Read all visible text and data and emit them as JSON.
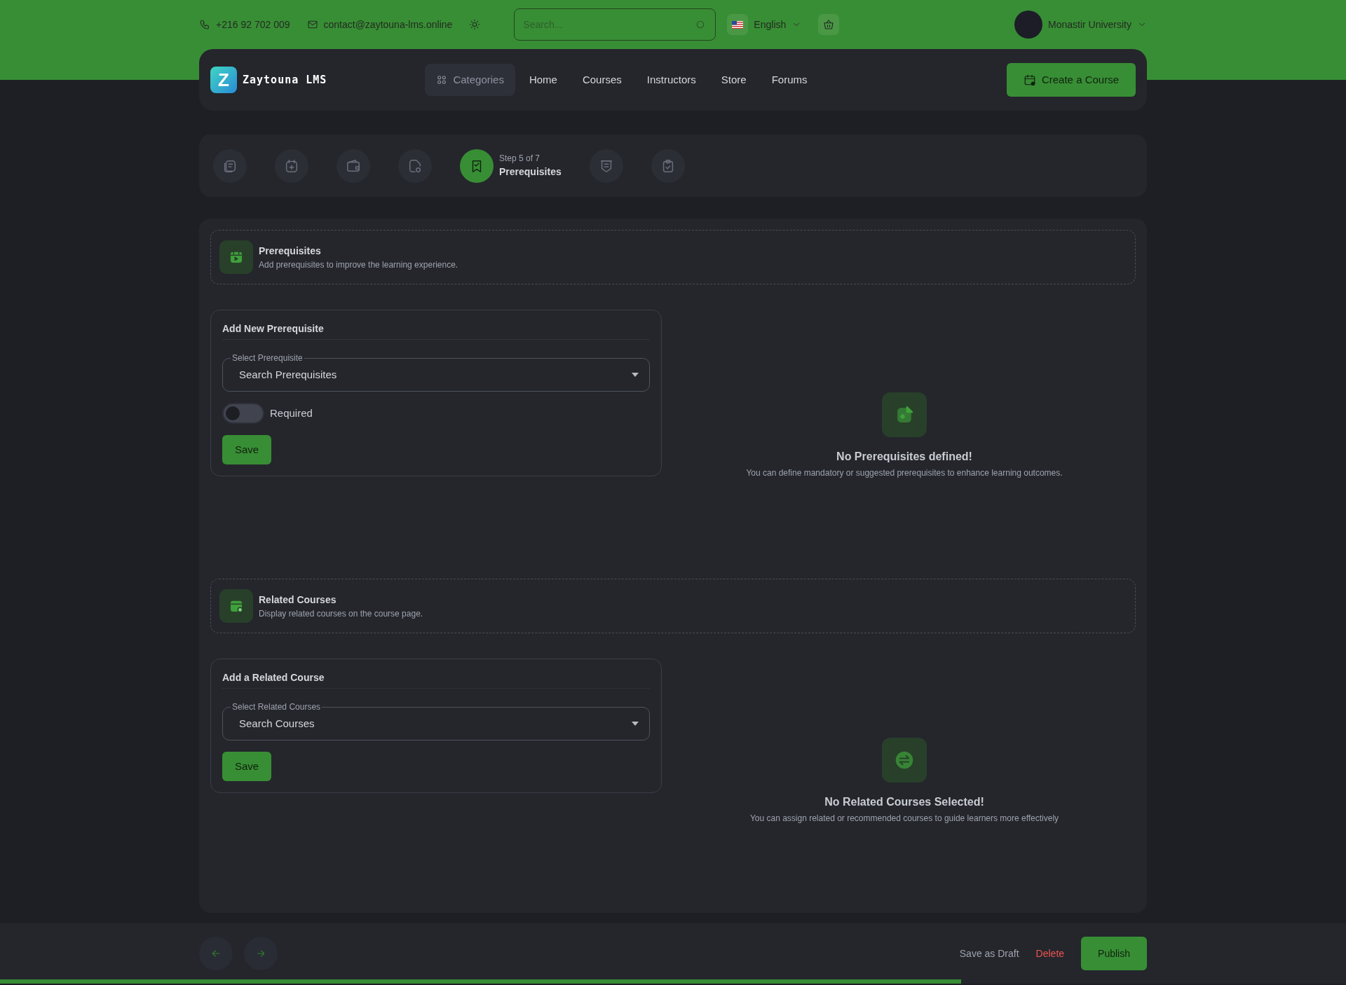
{
  "topbar": {
    "phone": "+216 92 702 009",
    "email": "contact@zaytouna-lms.online",
    "search_placeholder": "Search...",
    "language": "English",
    "user": "Monastir University"
  },
  "navbar": {
    "logo_mark": "Z",
    "brand": "Zaytouna LMS",
    "menu": [
      {
        "label": "Categories",
        "selected": true
      },
      {
        "label": "Home",
        "selected": false
      },
      {
        "label": "Courses",
        "selected": false
      },
      {
        "label": "Instructors",
        "selected": false
      },
      {
        "label": "Store",
        "selected": false
      },
      {
        "label": "Forums",
        "selected": false
      }
    ],
    "create_button": "Create a Course"
  },
  "steps": [
    {
      "kind": "notes",
      "selected": false
    },
    {
      "kind": "calendar",
      "selected": false
    },
    {
      "kind": "wallet",
      "selected": false
    },
    {
      "kind": "file",
      "selected": false
    },
    {
      "kind": "bookmark",
      "selected": true,
      "caption": "Step 5 of 7",
      "title": "Prerequisites"
    },
    {
      "kind": "badge",
      "selected": false
    },
    {
      "kind": "clipboard",
      "selected": false
    }
  ],
  "sections": [
    {
      "kind": "prerequisites",
      "title": "Prerequisites",
      "subtitle": "Add prerequisites to improve the learning experience.",
      "form": {
        "title": "Add New Prerequisite",
        "field_label": "Select Prerequisite",
        "placeholder": "Search Prerequisites",
        "toggle": {
          "label": "Required",
          "on": false
        },
        "button": "Save"
      },
      "empty": {
        "kind": "file",
        "title": "No Prerequisites defined!",
        "text": "You can define mandatory or suggested prerequisites to enhance learning outcomes."
      }
    },
    {
      "kind": "related",
      "title": "Related Courses",
      "subtitle": "Display related courses on the course page.",
      "form": {
        "title": "Add a Related Course",
        "field_label": "Select Related Courses",
        "placeholder": "Search Courses",
        "button": "Save"
      },
      "empty": {
        "kind": "swap",
        "title": "No Related Courses Selected!",
        "text": "You can assign related or recommended courses to guide learners more effectively"
      }
    }
  ],
  "footer": {
    "save_draft": "Save as Draft",
    "delete": "Delete",
    "publish": "Publish",
    "progress": {
      "level": 0.714
    }
  }
}
